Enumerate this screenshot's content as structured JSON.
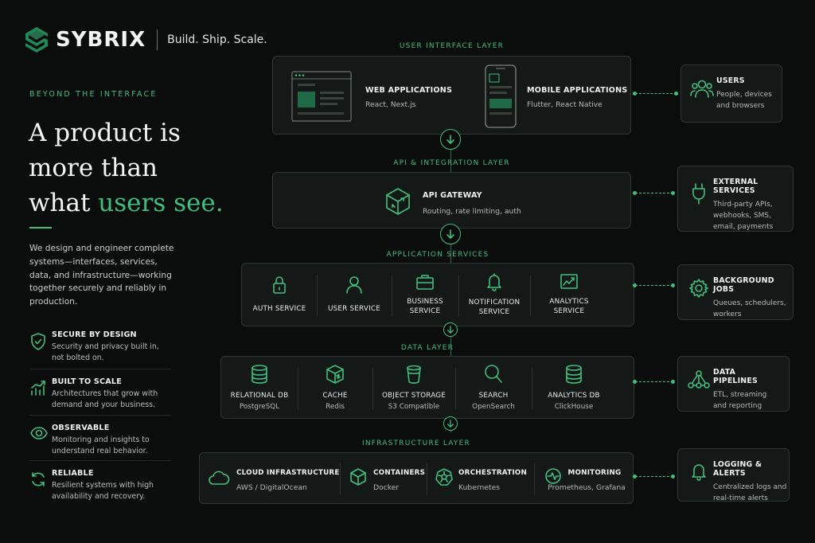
{
  "brand": {
    "name": "SYBRIX",
    "tagline": "Build. Ship. Scale."
  },
  "hero": {
    "eyebrow": "BEYOND THE INTERFACE",
    "headline_line1": "A product is",
    "headline_line2": "more than",
    "headline_line3_plain": "what ",
    "headline_line3_accent": "users see.",
    "intro": "We design and engineer complete systems—interfaces, services, data, and infrastructure—working together securely and reliably in production."
  },
  "features": [
    {
      "title": "SECURE BY DESIGN",
      "desc": "Security and privacy built in, not bolted on.",
      "icon": "shield-check-icon"
    },
    {
      "title": "BUILT TO SCALE",
      "desc": "Architectures that grow with demand and your business.",
      "icon": "growth-chart-icon"
    },
    {
      "title": "OBSERVABLE",
      "desc": "Monitoring and insights to understand real behavior.",
      "icon": "eye-icon"
    },
    {
      "title": "RELIABLE",
      "desc": "Resilient systems with high availability and recovery.",
      "icon": "refresh-icon"
    }
  ],
  "layers": {
    "ui": {
      "title": "USER INTERFACE LAYER",
      "items": [
        {
          "title": "WEB APPLICATIONS",
          "sub": "React, Next.js"
        },
        {
          "title": "MOBILE APPLICATIONS",
          "sub": "Flutter, React Native"
        }
      ]
    },
    "api": {
      "title": "API & INTEGRATION LAYER",
      "items": [
        {
          "title": "API GATEWAY",
          "sub": "Routing, rate limiting, auth"
        }
      ]
    },
    "app": {
      "title": "APPLICATION SERVICES",
      "items": [
        {
          "title": "AUTH SERVICE"
        },
        {
          "title": "USER SERVICE"
        },
        {
          "title": "BUSINESS\nSERVICE"
        },
        {
          "title": "NOTIFICATION\nSERVICE"
        },
        {
          "title": "ANALYTICS\nSERVICE"
        }
      ]
    },
    "data": {
      "title": "DATA LAYER",
      "items": [
        {
          "title": "RELATIONAL DB",
          "sub": "PostgreSQL"
        },
        {
          "title": "CACHE",
          "sub": "Redis"
        },
        {
          "title": "OBJECT STORAGE",
          "sub": "S3 Compatible"
        },
        {
          "title": "SEARCH",
          "sub": "OpenSearch"
        },
        {
          "title": "ANALYTICS DB",
          "sub": "ClickHouse"
        }
      ]
    },
    "infra": {
      "title": "INFRASTRUCTURE LAYER",
      "items": [
        {
          "title": "CLOUD INFRASTRUCTURE",
          "sub": "AWS / DigitalOcean"
        },
        {
          "title": "CONTAINERS",
          "sub": "Docker"
        },
        {
          "title": "ORCHESTRATION",
          "sub": "Kubernetes"
        },
        {
          "title": "MONITORING",
          "sub": "Prometheus, Grafana"
        }
      ]
    }
  },
  "side": [
    {
      "title": "USERS",
      "desc": "People, devices and browsers"
    },
    {
      "title": "EXTERNAL SERVICES",
      "desc": "Third-party APIs, webhooks, SMS, email, payments"
    },
    {
      "title": "BACKGROUND JOBS",
      "desc": "Queues, schedulers, workers"
    },
    {
      "title": "DATA PIPELINES",
      "desc": "ETL, streaming and reporting"
    },
    {
      "title": "LOGGING & ALERTS",
      "desc": "Centralized logs and real-time alerts"
    }
  ],
  "colors": {
    "accent": "#3fbf7f",
    "background": "#0b0d0c",
    "panel": "#141816"
  }
}
